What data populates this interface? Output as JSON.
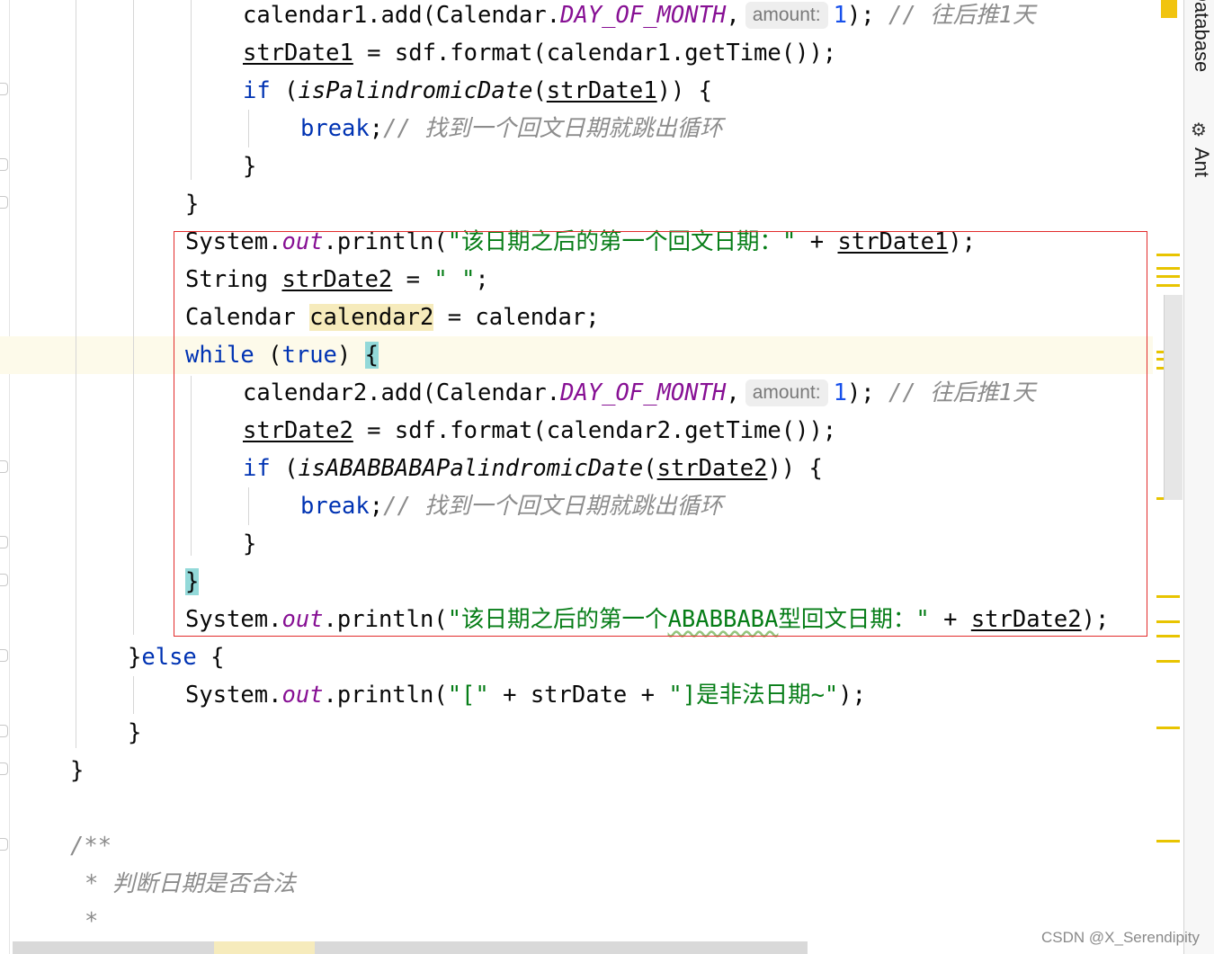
{
  "code": {
    "l1": {
      "a": "calendar1.add(Calendar.",
      "field": "DAY_OF_MONTH",
      "b": ",",
      "hint": "amount:",
      "num": "1",
      "c": ");",
      "comment": "// 往后推1天"
    },
    "l2": {
      "var": "strDate1",
      "rest": " = sdf.format(calendar1.getTime());"
    },
    "l3": {
      "kw": "if",
      "a": " (",
      "method": "isPalindromicDate",
      "b": "(",
      "var": "strDate1",
      "c": ")) {"
    },
    "l4": {
      "kw": "break",
      "a": ";",
      "comment": "// 找到一个回文日期就跳出循环"
    },
    "l5": {
      "text": "}"
    },
    "l6": {
      "text": "}"
    },
    "l7": {
      "a": "System.",
      "field": "out",
      "b": ".println(",
      "str": "\"该日期之后的第一个回文日期：\"",
      "c": " + ",
      "var": "strDate1",
      "d": ");"
    },
    "l8": {
      "a": "String ",
      "var": "strDate2",
      "b": " = ",
      "str": "\" \"",
      "c": ";"
    },
    "l9": {
      "a": "Calendar ",
      "var": "calendar2",
      "b": " = calendar;"
    },
    "l10": {
      "kw": "while",
      "a": " (",
      "kw2": "true",
      "b": ") ",
      "brace": "{"
    },
    "l11": {
      "a": "calendar2.add(Calendar.",
      "field": "DAY_OF_MONTH",
      "b": ",",
      "hint": "amount:",
      "num": "1",
      "c": ");",
      "comment": "// 往后推1天"
    },
    "l12": {
      "var": "strDate2",
      "rest": " = sdf.format(calendar2.getTime());"
    },
    "l13": {
      "kw": "if",
      "a": " (",
      "method": "isABABBABAPalindromicDate",
      "b": "(",
      "var": "strDate2",
      "c": ")) {"
    },
    "l14": {
      "kw": "break",
      "a": ";",
      "comment": "// 找到一个回文日期就跳出循环"
    },
    "l15": {
      "text": "}"
    },
    "l16": {
      "brace": "}"
    },
    "l17": {
      "a": "System.",
      "field": "out",
      "b": ".println(",
      "str1": "\"该日期之后的第一个",
      "str_wavy": "ABABBABA",
      "str2": "型回文日期：\"",
      "c": " + ",
      "var": "strDate2",
      "d": ");"
    },
    "l18": {
      "a": "}",
      "kw": "else",
      "b": " {"
    },
    "l19": {
      "a": "System.",
      "field": "out",
      "b": ".println(",
      "str1": "\"[\"",
      "c": " + strDate + ",
      "str2": "\"]是非法日期~\"",
      "d": ");"
    },
    "l20": {
      "text": "}"
    },
    "l21": {
      "text": "}"
    },
    "l22": {
      "text": "/**"
    },
    "l23": {
      "text": "* 判断日期是否合法"
    },
    "l24": {
      "text": "*"
    }
  },
  "sidebar": {
    "database_label": "Database",
    "ant_label": "Ant",
    "ant_icon": "ant-icon"
  },
  "watermark": "CSDN @X_Serendipity",
  "colors": {
    "keyword": "#0033b3",
    "field": "#871094",
    "string": "#067d17",
    "comment": "#8c8c8c",
    "number": "#1750eb",
    "selection_border": "#e22b2b",
    "current_line": "#fdfaea",
    "brace_match": "#93d9d9",
    "marker": "#e8c400"
  }
}
